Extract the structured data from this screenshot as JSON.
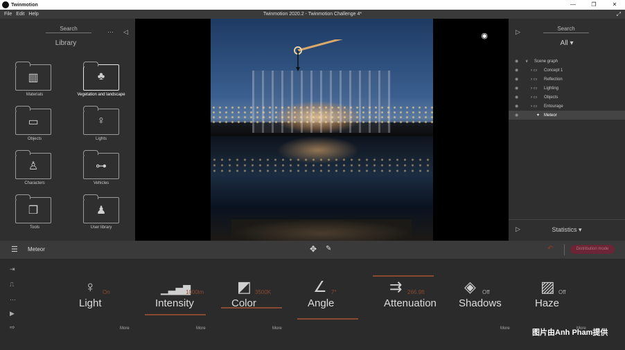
{
  "window": {
    "app_name": "Twinmotion",
    "doc_title": "Twinmotion 2020.2 - Twinmotion Challenge 4*",
    "controls": [
      "—",
      "❐",
      "✕"
    ]
  },
  "menu": [
    "File",
    "Edit",
    "Help"
  ],
  "library": {
    "search_label": "Search",
    "title": "Library",
    "items": [
      {
        "label": "Materials",
        "icon": "fan-deck-icon",
        "glyph": "▥"
      },
      {
        "label": "Vegetation and landscape",
        "icon": "tree-icon",
        "glyph": "♣"
      },
      {
        "label": "Objects",
        "icon": "sofa-icon",
        "glyph": "▭"
      },
      {
        "label": "Lights",
        "icon": "lightbulb-icon",
        "glyph": "♀"
      },
      {
        "label": "Characters",
        "icon": "person-icon",
        "glyph": "♙"
      },
      {
        "label": "Vehicles",
        "icon": "car-icon",
        "glyph": "⊶"
      },
      {
        "label": "Tools",
        "icon": "cubes-icon",
        "glyph": "❒"
      },
      {
        "label": "User library",
        "icon": "user-icon",
        "glyph": "♟"
      }
    ]
  },
  "scene": {
    "search_label": "Search",
    "filter": "All",
    "tree": [
      {
        "label": "Scene graph",
        "level": 0
      },
      {
        "label": "Concept 1",
        "level": 1
      },
      {
        "label": "Reflection",
        "level": 1
      },
      {
        "label": "Lighting",
        "level": 1
      },
      {
        "label": "Objects",
        "level": 1
      },
      {
        "label": "Entourage",
        "level": 1
      },
      {
        "label": "Meteor",
        "level": 2
      }
    ],
    "statistics_label": "Statistics"
  },
  "toolbar": {
    "selection_name": "Meteor",
    "distribution_label": "Distribution mode"
  },
  "properties": [
    {
      "label": "Light",
      "value": "On",
      "icon": "lightbulb-icon",
      "glyph": "♀"
    },
    {
      "label": "Intensity",
      "value": "1000lm",
      "icon": "intensity-bars-icon",
      "glyph": "▁▃▅▇"
    },
    {
      "label": "Color",
      "value": "3500K",
      "icon": "paint-bucket-icon",
      "glyph": "◩"
    },
    {
      "label": "Angle",
      "value": "7°",
      "icon": "angle-icon",
      "glyph": "∠"
    },
    {
      "label": "Attenuation",
      "value": "266.9ft",
      "icon": "attenuation-icon",
      "glyph": "⇉"
    },
    {
      "label": "Shadows",
      "value": "Off",
      "icon": "cube-icon",
      "glyph": "◈"
    },
    {
      "label": "Haze",
      "value": "Off",
      "icon": "haze-icon",
      "glyph": "▨"
    }
  ],
  "more_label": "More",
  "watermark": "图片由Anh Pham提供",
  "colors": {
    "accent": "#8a4a32",
    "distribution": "#6b2536"
  }
}
